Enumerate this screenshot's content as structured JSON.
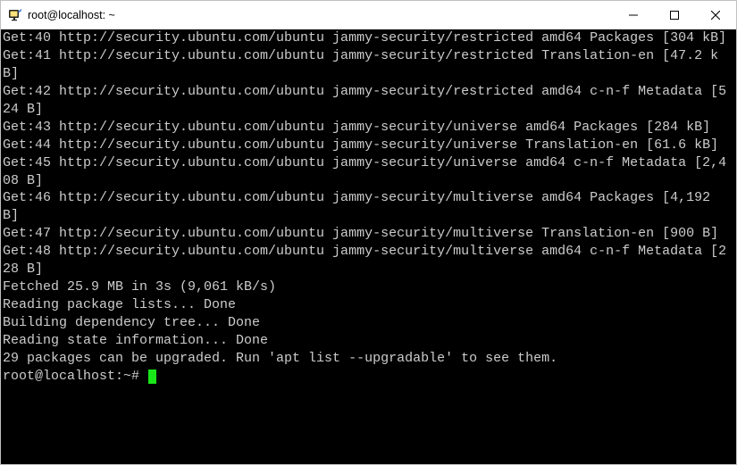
{
  "window": {
    "title": "root@localhost: ~"
  },
  "icon_colors": {
    "screen_bg": "#222222",
    "screen_inner": "#ffe27a",
    "accent": "#3a77d8"
  },
  "terminal": {
    "lines": [
      "Get:40 http://security.ubuntu.com/ubuntu jammy-security/restricted amd64 Packages [304 kB]",
      "Get:41 http://security.ubuntu.com/ubuntu jammy-security/restricted Translation-en [47.2 kB]",
      "Get:42 http://security.ubuntu.com/ubuntu jammy-security/restricted amd64 c-n-f Metadata [524 B]",
      "Get:43 http://security.ubuntu.com/ubuntu jammy-security/universe amd64 Packages [284 kB]",
      "Get:44 http://security.ubuntu.com/ubuntu jammy-security/universe Translation-en [61.6 kB]",
      "Get:45 http://security.ubuntu.com/ubuntu jammy-security/universe amd64 c-n-f Metadata [2,408 B]",
      "Get:46 http://security.ubuntu.com/ubuntu jammy-security/multiverse amd64 Packages [4,192 B]",
      "Get:47 http://security.ubuntu.com/ubuntu jammy-security/multiverse Translation-en [900 B]",
      "Get:48 http://security.ubuntu.com/ubuntu jammy-security/multiverse amd64 c-n-f Metadata [228 B]",
      "Fetched 25.9 MB in 3s (9,061 kB/s)",
      "Reading package lists... Done",
      "Building dependency tree... Done",
      "Reading state information... Done",
      "29 packages can be upgraded. Run 'apt list --upgradable' to see them."
    ],
    "prompt": "root@localhost:~# "
  }
}
